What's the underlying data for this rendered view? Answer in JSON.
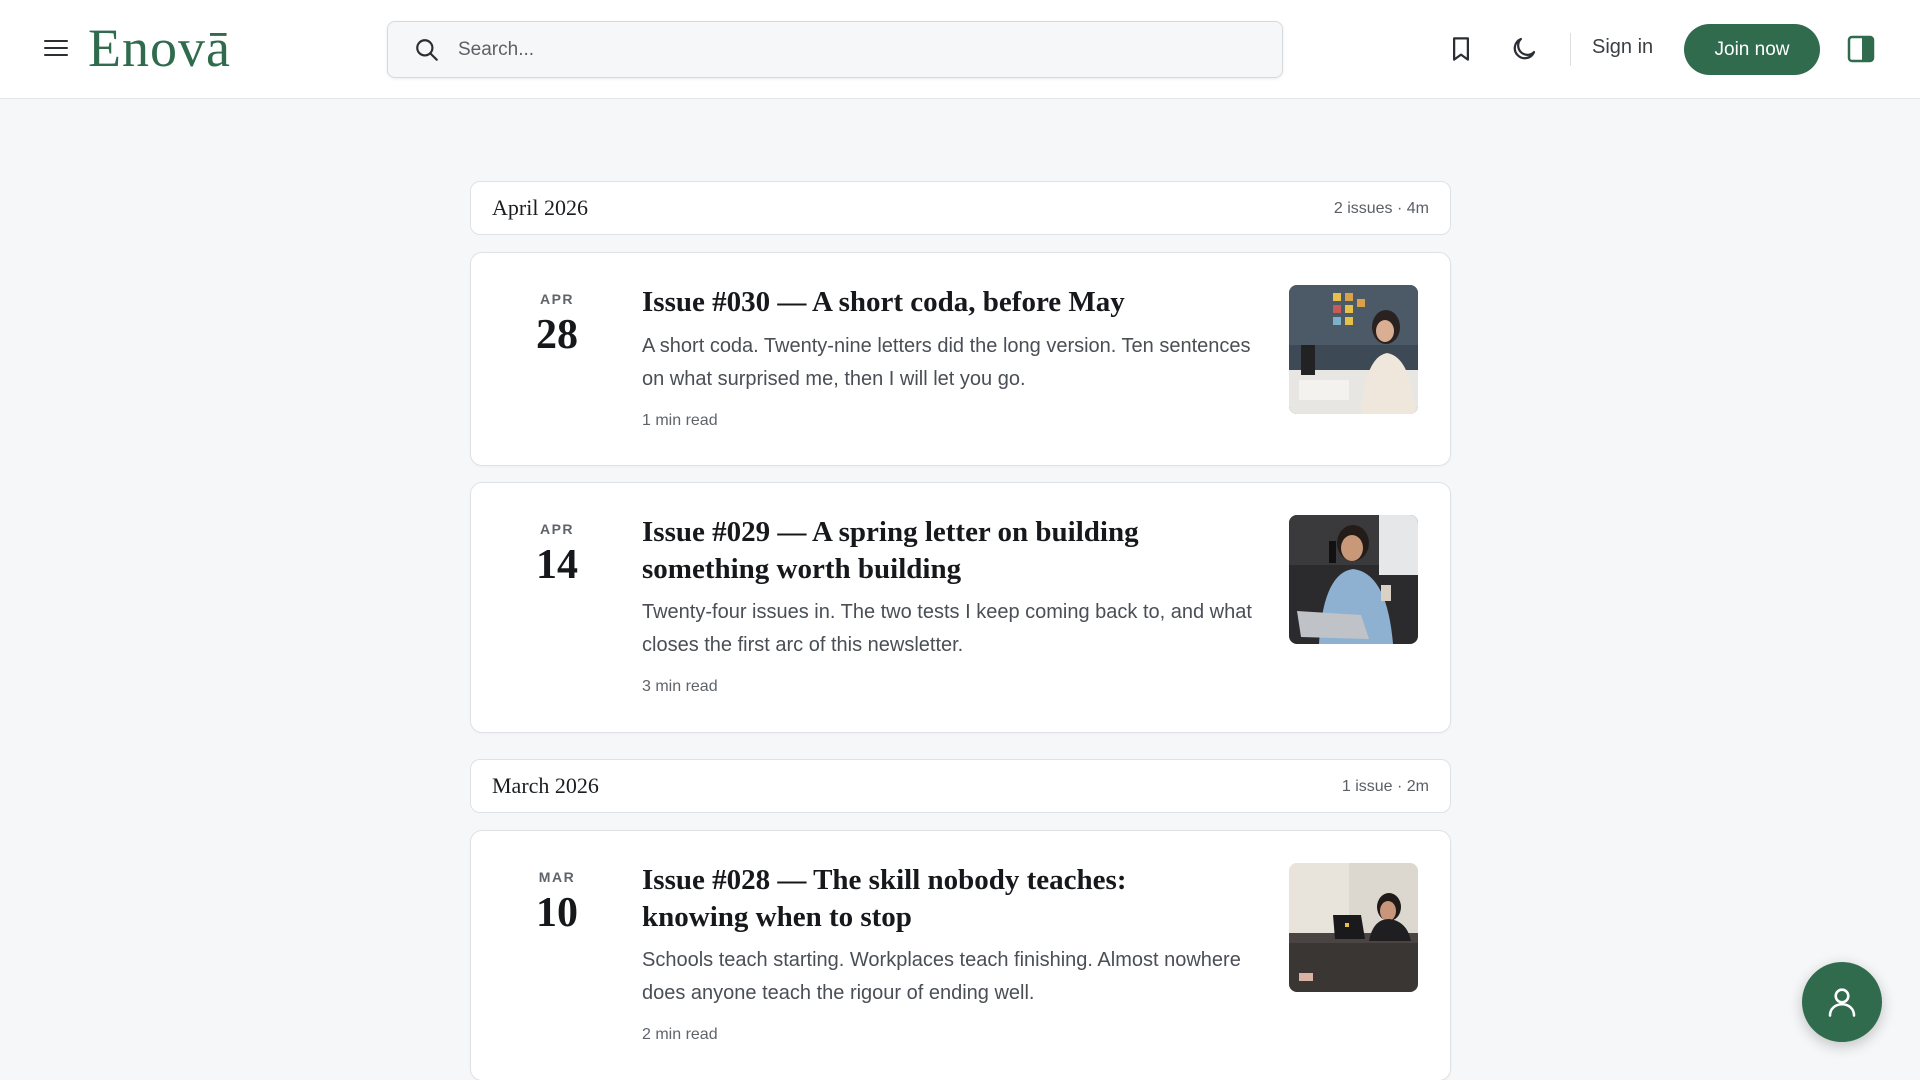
{
  "header": {
    "logo": "Enovā",
    "search_placeholder": "Search...",
    "sign_in": "Sign in",
    "join_now": "Join now",
    "icons": [
      "menu-icon",
      "search-icon",
      "bookmark-icon",
      "moon-icon",
      "panel-toggle-icon"
    ],
    "accent_color": "#2f6b4c"
  },
  "months": [
    {
      "name": "April 2026",
      "meta": "2 issues · 4m"
    },
    {
      "name": "March 2026",
      "meta": "1 issue · 2m"
    }
  ],
  "issues": [
    {
      "month": "APR",
      "day": "28",
      "title": "Issue #030 — A short coda, before May",
      "description": "A short coda. Twenty-nine letters did the long version. Ten sentences on what surprised me, then I will let you go.",
      "read_time": "1 min read",
      "thumbnail": "woman-working-at-desk-photo"
    },
    {
      "month": "APR",
      "day": "14",
      "title": "Issue #029 — A spring letter on building something worth building",
      "description": "Twenty-four issues in. The two tests I keep coming back to, and what closes the first arc of this newsletter.",
      "read_time": "3 min read",
      "thumbnail": "woman-on-phone-with-laptop-photo"
    },
    {
      "month": "MAR",
      "day": "10",
      "title": "Issue #028 — The skill nobody teaches: knowing when to stop",
      "description": "Schools teach starting. Workplaces teach finishing. Almost nowhere does anyone teach the rigour of ending well.",
      "read_time": "2 min read",
      "thumbnail": "woman-at-laptop-desk-photo"
    }
  ],
  "fab": {
    "icon": "user-icon"
  }
}
